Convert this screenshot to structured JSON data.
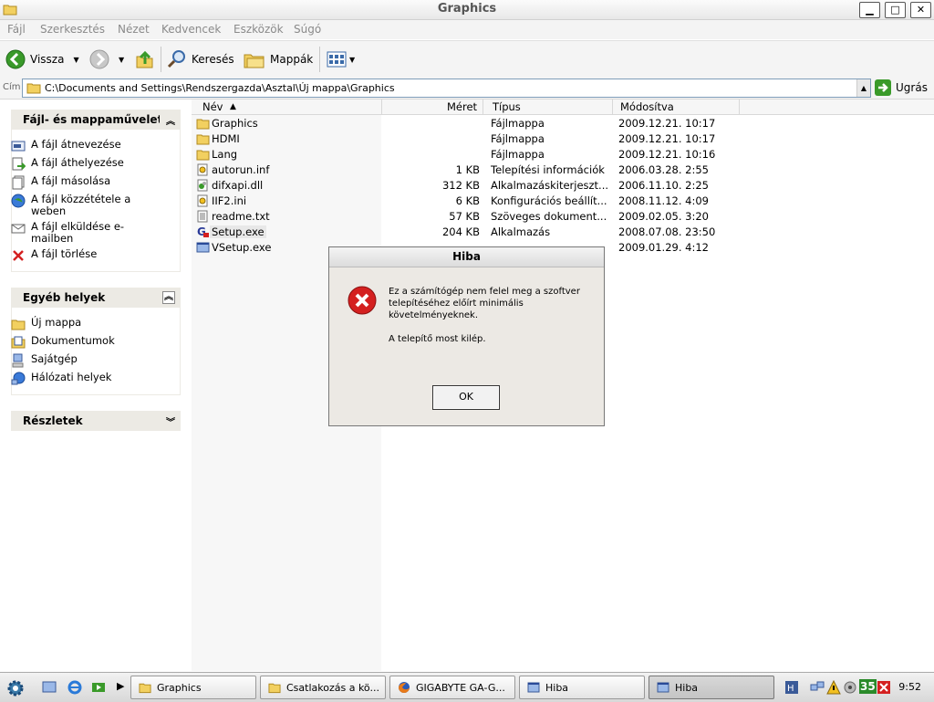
{
  "window": {
    "title": "Graphics"
  },
  "menu": [
    "Fájl",
    "Szerkesztés",
    "Nézet",
    "Kedvencek",
    "Eszközök",
    "Súgó"
  ],
  "toolbar": {
    "back": "Vissza",
    "search": "Keresés",
    "folders": "Mappák"
  },
  "address": {
    "label": "Cím",
    "path": "C:\\Documents and Settings\\Rendszergazda\\Asztal\\Új mappa\\Graphics",
    "go": "Ugrás"
  },
  "tasks": {
    "title": "Fájl- és mappaműveletek",
    "items": [
      "A fájl átnevezése",
      "A fájl áthelyezése",
      "A fájl másolása",
      "A fájl közzététele a weben",
      "A fájl elküldése e-mailben",
      "A fájl törlése"
    ]
  },
  "places": {
    "title": "Egyéb helyek",
    "items": [
      "Új mappa",
      "Dokumentumok",
      "Sajátgép",
      "Hálózati helyek"
    ]
  },
  "details": {
    "title": "Részletek"
  },
  "columns": {
    "name": "Név",
    "size": "Méret",
    "type": "Típus",
    "modified": "Módosítva"
  },
  "files": [
    {
      "name": "Graphics",
      "size": "",
      "type": "Fájlmappa",
      "modified": "2009.12.21. 10:17",
      "icon": "folder-icon"
    },
    {
      "name": "HDMI",
      "size": "",
      "type": "Fájlmappa",
      "modified": "2009.12.21. 10:17",
      "icon": "folder-icon"
    },
    {
      "name": "Lang",
      "size": "",
      "type": "Fájlmappa",
      "modified": "2009.12.21. 10:16",
      "icon": "folder-icon"
    },
    {
      "name": "autorun.inf",
      "size": "1 KB",
      "type": "Telepítési információk",
      "modified": "2006.03.28. 2:55",
      "icon": "inf-file-icon"
    },
    {
      "name": "difxapi.dll",
      "size": "312 KB",
      "type": "Alkalmazáskiterjeszt...",
      "modified": "2006.11.10. 2:25",
      "icon": "dll-file-icon"
    },
    {
      "name": "IIF2.ini",
      "size": "6 KB",
      "type": "Konfigurációs beállít...",
      "modified": "2008.11.12. 4:09",
      "icon": "ini-file-icon"
    },
    {
      "name": "readme.txt",
      "size": "57 KB",
      "type": "Szöveges dokument...",
      "modified": "2009.02.05. 3:20",
      "icon": "txt-file-icon"
    },
    {
      "name": "Setup.exe",
      "size": "204 KB",
      "type": "Alkalmazás",
      "modified": "2008.07.08. 23:50",
      "icon": "setup-exe-icon"
    },
    {
      "name": "VSetup.exe",
      "size": "",
      "type": "",
      "modified": "2009.01.29. 4:12",
      "icon": "exe-file-icon"
    }
  ],
  "dialog": {
    "title": "Hiba",
    "message": "Ez a számítógép nem felel meg a szoftver telepítéséhez előírt minimális követelményeknek.",
    "message2": "A telepítő most kilép.",
    "ok": "OK"
  },
  "taskbar": {
    "buttons": [
      "Graphics",
      "Csatlakozás a kö...",
      "GIGABYTE GA-G...",
      "Hiba",
      "Hiba"
    ],
    "tray_number": "35",
    "clock": "9:52"
  },
  "colors": {
    "error_red": "#d42020",
    "folder_yellow": "#f2d060",
    "go_green": "#3a9a2a"
  }
}
